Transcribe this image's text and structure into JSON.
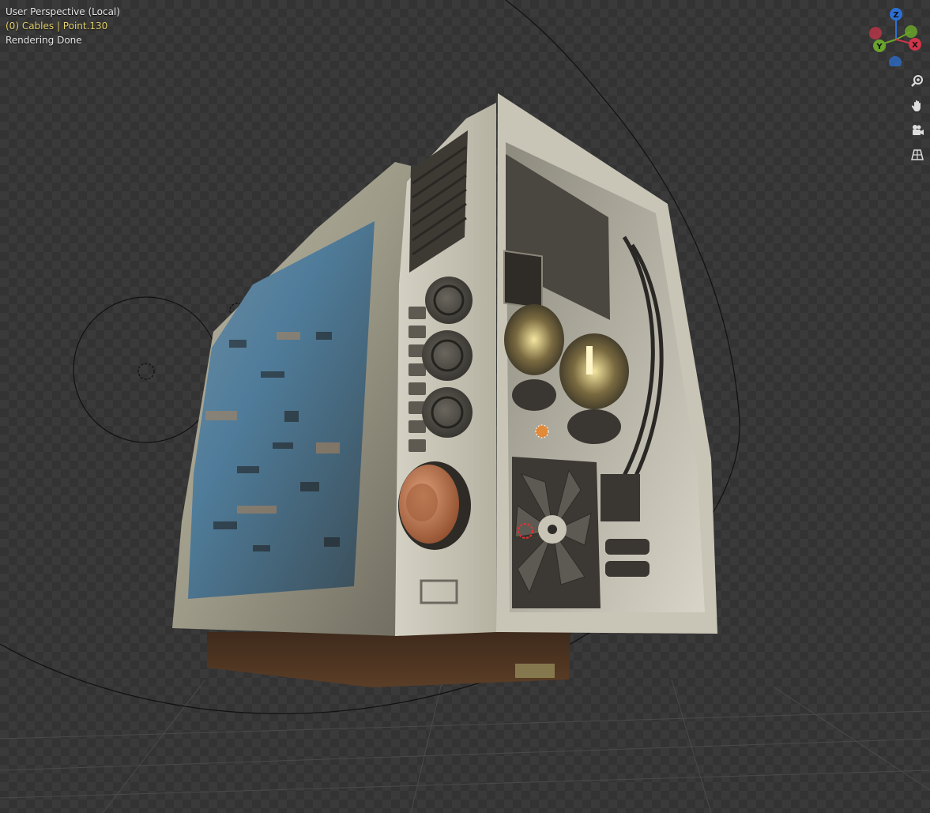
{
  "viewport": {
    "view_label": "User Perspective (Local)",
    "selection_label": "(0) Cables | Point.130",
    "status_label": "Rendering Done"
  },
  "gizmo": {
    "axes": [
      {
        "label": "Z",
        "color": "#2c6fd1"
      },
      {
        "label": "X",
        "color": "#d0364a"
      },
      {
        "label": "Y",
        "color": "#6aa32c"
      }
    ]
  },
  "nav_tools": [
    {
      "icon": "zoom-icon"
    },
    {
      "icon": "hand-pan-icon"
    },
    {
      "icon": "camera-icon"
    },
    {
      "icon": "perspective-grid-icon"
    }
  ],
  "colors": {
    "viewport_bg": "#3a3a3a",
    "selection_text": "#e6d36c",
    "object_frame": "#c9c6b4",
    "copper_knob": "#c47a50",
    "screen_blue": "#4f7c9a"
  }
}
